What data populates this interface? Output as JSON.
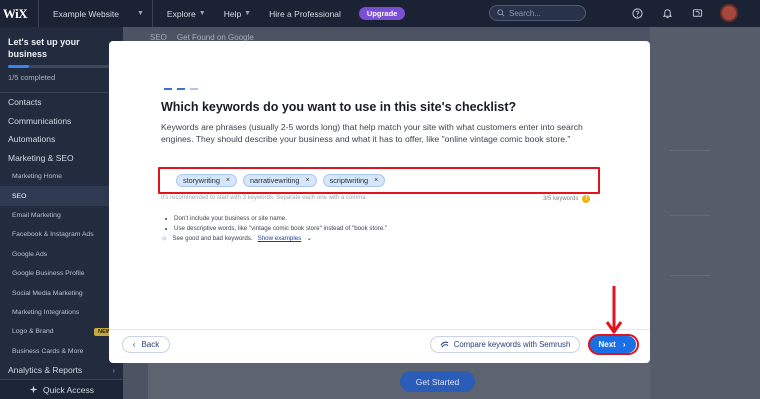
{
  "topbar": {
    "logo": "WiX",
    "site_name": "Example Website",
    "nav": [
      "Explore",
      "Help",
      "Hire a Professional"
    ],
    "upgrade_label": "Upgrade",
    "search_placeholder": "Search..."
  },
  "sidebar": {
    "setup_title": "Let's set up your business",
    "setup_status": "1/5 completed",
    "setup_progress": 0.2,
    "items": [
      {
        "label": "Contacts",
        "has_arrow": true
      },
      {
        "label": "Communications",
        "has_arrow": true
      },
      {
        "label": "Automations",
        "has_arrow": false
      },
      {
        "label": "Marketing & SEO",
        "expanded": true
      }
    ],
    "sub_items": [
      "Marketing Home",
      "SEO",
      "Email Marketing",
      "Facebook & Instagram Ads",
      "Google Ads",
      "Google Business Profile",
      "Social Media Marketing",
      "Marketing Integrations",
      "Logo & Brand",
      "Business Cards & More"
    ],
    "logo_brand_badge": "NEW",
    "analytics_label": "Analytics & Reports",
    "quick_access": "Quick Access"
  },
  "breadcrumb": {
    "items": [
      "SEO",
      "Get Found on Google"
    ]
  },
  "page": {
    "get_started": "Get Started"
  },
  "modal": {
    "heading": "Which keywords do you want to use in this site's checklist?",
    "description": "Keywords are phrases (usually 2-5 words long) that help match your site with what customers enter into search engines. They should describe your business and what it has to offer, like \"online vintage comic book store.\"",
    "keywords": [
      "storywriting",
      "narrativewriting",
      "scriptwriting"
    ],
    "hint": "It's recommended to start with 3 keywords. Separate each one with a comma.",
    "count": "3/5 keywords",
    "tips": [
      "Don't include your business or site name.",
      "Use descriptive words, like \"vintage comic book store\" instead of \"book store.\""
    ],
    "examples_prefix": "See good and bad keywords.",
    "examples_link": "Show examples",
    "back_label": "Back",
    "semrush_label": "Compare keywords with Semrush",
    "next_label": "Next"
  },
  "colors": {
    "accent": "#1b6fe5",
    "highlight": "#e1131c",
    "upgrade": "#7a4fd4"
  }
}
